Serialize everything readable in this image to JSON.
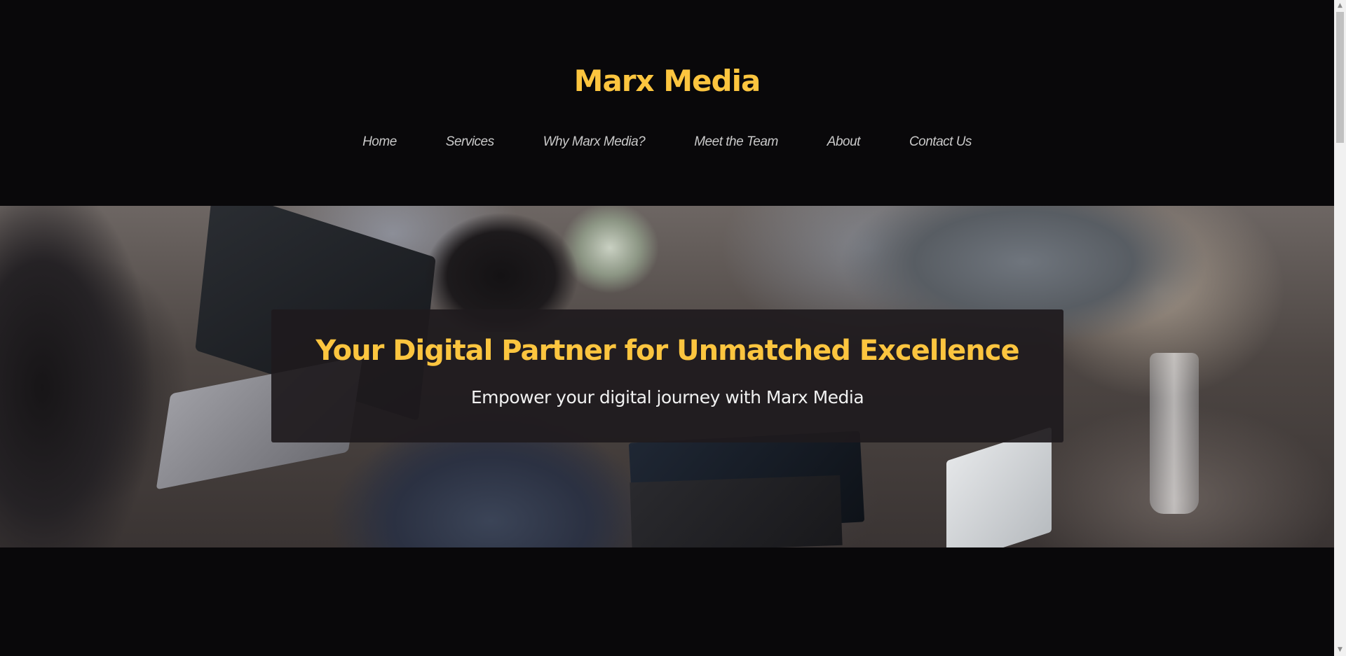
{
  "site": {
    "title": "Marx Media",
    "brand_color": "#fcc53f",
    "background_color": "#09080a"
  },
  "nav": {
    "items": [
      {
        "label": "Home"
      },
      {
        "label": "Services"
      },
      {
        "label": "Why Marx Media?"
      },
      {
        "label": "Meet the Team"
      },
      {
        "label": "About"
      },
      {
        "label": "Contact Us"
      }
    ],
    "text_color": "#c9c9c9"
  },
  "hero": {
    "title": "Your Digital Partner for Unmatched Excellence",
    "subtitle": "Empower your digital journey with Marx Media",
    "card_color": "#1e1a1d",
    "image": "team-working-on-laptops-photo"
  },
  "scrollbar": {
    "up_icon": "scroll-up-arrow-icon",
    "down_icon": "scroll-down-arrow-icon",
    "up_glyph": "▲",
    "down_glyph": "▼"
  }
}
